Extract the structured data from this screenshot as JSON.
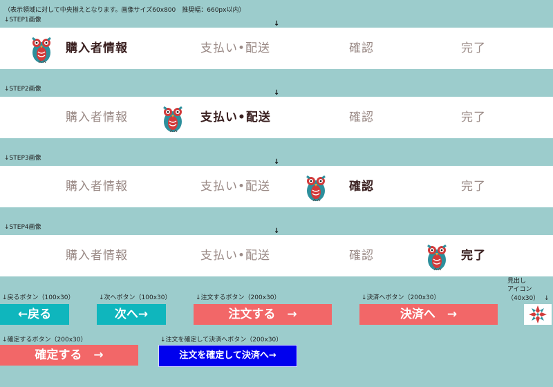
{
  "header_note": "（表示領域に対して中央揃えとなります。画像サイズ60x800　推奨幅：660px以内）",
  "steps": [
    {
      "label": "↓STEP1画像",
      "active_index": 0
    },
    {
      "label": "↓STEP2画像",
      "active_index": 1
    },
    {
      "label": "↓STEP3画像",
      "active_index": 2
    },
    {
      "label": "↓STEP4画像",
      "active_index": 3
    }
  ],
  "step_names": [
    "購入者情報",
    "支払い•配送",
    "確認",
    "完了"
  ],
  "center_arrow": "↓",
  "buttons": {
    "back": {
      "caption": "↓戻るボタン（100x30）",
      "label": "←戻る"
    },
    "next": {
      "caption": "↓次へボタン（100x30）",
      "label": "次へ→"
    },
    "order": {
      "caption": "↓注文するボタン（200x30）",
      "label": "注文する　→"
    },
    "payment": {
      "caption": "↓決済へボタン（200x30）",
      "label": "決済へ　→"
    },
    "confirm": {
      "caption": "↓確定するボタン（200x30）",
      "label": "確定する　→"
    },
    "confirm_pay": {
      "caption": "↓注文を確定して決済へボタン（200x30）",
      "label": "注文を確定して決済へ→"
    }
  },
  "heading_icon": {
    "caption_line1": "見出し",
    "caption_line2": "アイコン",
    "caption_line3": "（40x30）",
    "caption_arrow": "↓",
    "icon": "red-snowflake-icon"
  },
  "colors": {
    "background": "#9ccccc",
    "teal_button": "#0fb6bd",
    "coral_button": "#f26768",
    "blue_button": "#0000ee",
    "owl_teal": "#2d8f9c",
    "owl_red": "#d23a3a"
  }
}
